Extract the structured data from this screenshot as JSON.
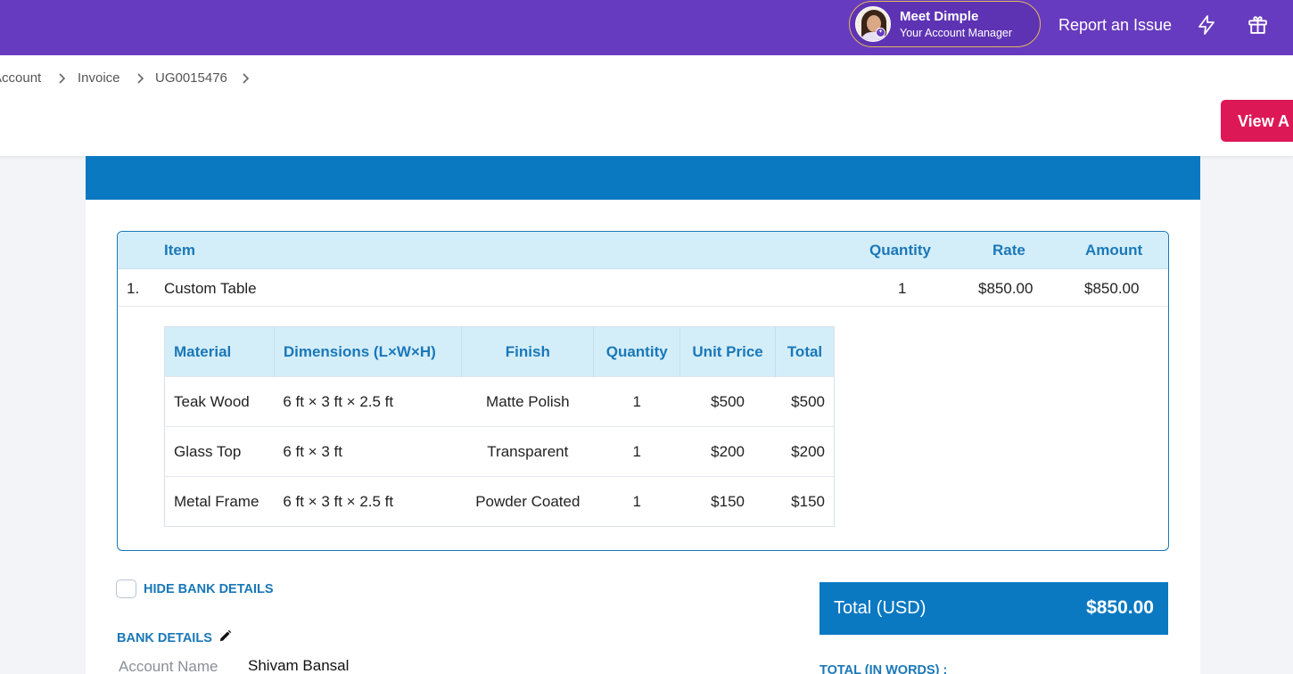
{
  "topbar": {
    "manager_name": "Meet Dimple",
    "manager_role": "Your Account Manager",
    "report_link": "Report an Issue",
    "colors": {
      "bar": "#673bbf",
      "pill_border": "#e0b85a"
    },
    "icons": [
      "bolt-icon",
      "gift-icon"
    ]
  },
  "breadcrumb": [
    "Account",
    "Invoice",
    "UG0015476"
  ],
  "header": {
    "view_button": "View A"
  },
  "items_table": {
    "headers": {
      "item": "Item",
      "quantity": "Quantity",
      "rate": "Rate",
      "amount": "Amount"
    },
    "rows": [
      {
        "index": "1.",
        "name": "Custom Table",
        "quantity": "1",
        "rate": "$850.00",
        "amount": "$850.00"
      }
    ]
  },
  "materials_table": {
    "headers": [
      "Material",
      "Dimensions (L×W×H)",
      "Finish",
      "Quantity",
      "Unit Price",
      "Total"
    ],
    "rows": [
      [
        "Teak Wood",
        "6 ft × 3 ft × 2.5 ft",
        "Matte Polish",
        "1",
        "$500",
        "$500"
      ],
      [
        "Glass Top",
        "6 ft × 3 ft",
        "Transparent",
        "1",
        "$200",
        "$200"
      ],
      [
        "Metal Frame",
        "6 ft × 3 ft × 2.5 ft",
        "Powder Coated",
        "1",
        "$150",
        "$150"
      ]
    ]
  },
  "bank": {
    "hide_label": "HIDE BANK DETAILS",
    "hide_checked": false,
    "title": "BANK DETAILS",
    "account_name_label": "Account Name",
    "account_name_value": "Shivam Bansal"
  },
  "totals": {
    "label": "Total (USD)",
    "value": "$850.00",
    "in_words_label": "TOTAL (IN WORDS) :"
  },
  "colors": {
    "accent": "#0a79c2",
    "view_button": "#dd1857",
    "table_header": "#d4eef9"
  }
}
